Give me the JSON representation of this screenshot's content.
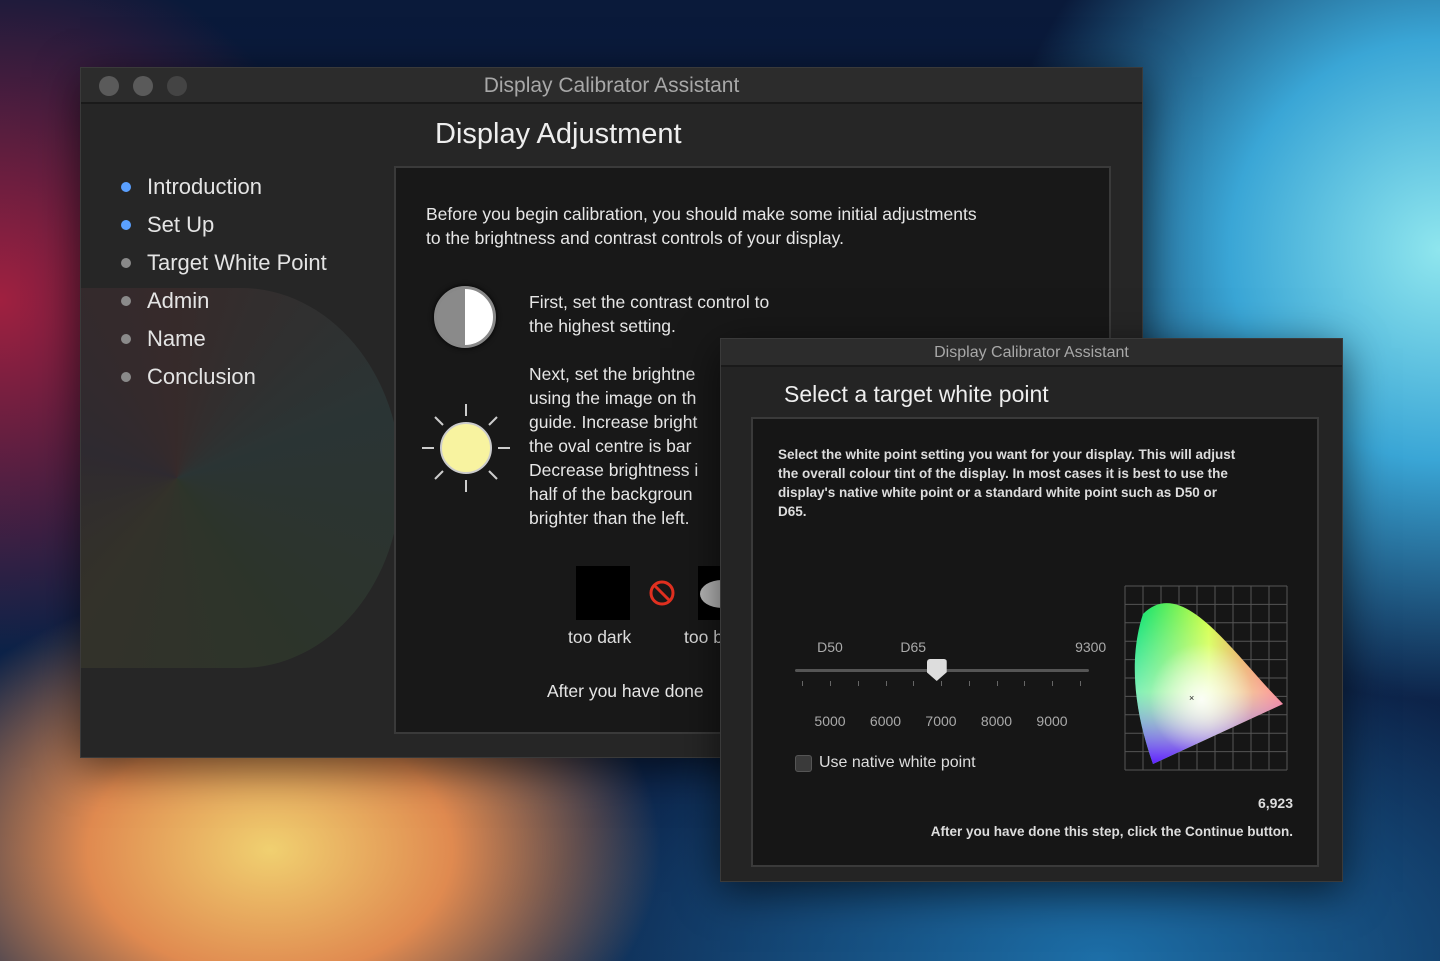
{
  "main_window": {
    "title": "Display Calibrator Assistant",
    "heading": "Display Adjustment",
    "steps": [
      {
        "label": "Introduction",
        "state": "done"
      },
      {
        "label": "Set Up",
        "state": "current"
      },
      {
        "label": "Target White Point",
        "state": "pending"
      },
      {
        "label": "Admin",
        "state": "pending"
      },
      {
        "label": "Name",
        "state": "pending"
      },
      {
        "label": "Conclusion",
        "state": "pending"
      }
    ],
    "intro_lines": [
      "Before you begin calibration, you should make some initial adjustments",
      "to the brightness and contrast controls of your display."
    ],
    "contrast_lines": [
      "First, set the contrast control to",
      "the highest setting."
    ],
    "brightness_lines": [
      "Next, set the brightne",
      "using the image on th",
      "guide. Increase bright",
      "the oval centre is bar",
      "Decrease brightness i",
      "half of the backgroun",
      "brighter than the left."
    ],
    "too_dark_label": "too dark",
    "too_bright_label": "too b",
    "footer": "After you have done"
  },
  "white_point_window": {
    "title": "Display Calibrator Assistant",
    "heading": "Select a target white point",
    "description_lines": [
      "Select the white point setting you want for your display. This will adjust",
      "the overall colour tint of the display. In most cases it is best to use the",
      "display's native white point or a standard white point such as D50 or",
      "D65."
    ],
    "presets": [
      {
        "label": "D50",
        "kelvin": 5000
      },
      {
        "label": "D65",
        "kelvin": 6500
      },
      {
        "label": "9300",
        "kelvin": 9300
      }
    ],
    "scale_labels": [
      "5000",
      "6000",
      "7000",
      "8000",
      "9000"
    ],
    "slider_value": 6923,
    "value_readout": "6,923",
    "native_checkbox_label": "Use native white point",
    "native_checked": false,
    "footer": "After you have done this step, click the Continue button."
  },
  "colors": {
    "accent_blue": "#5aa0ff",
    "forbidden_red": "#e03020",
    "sun": "#f8f3a0"
  }
}
